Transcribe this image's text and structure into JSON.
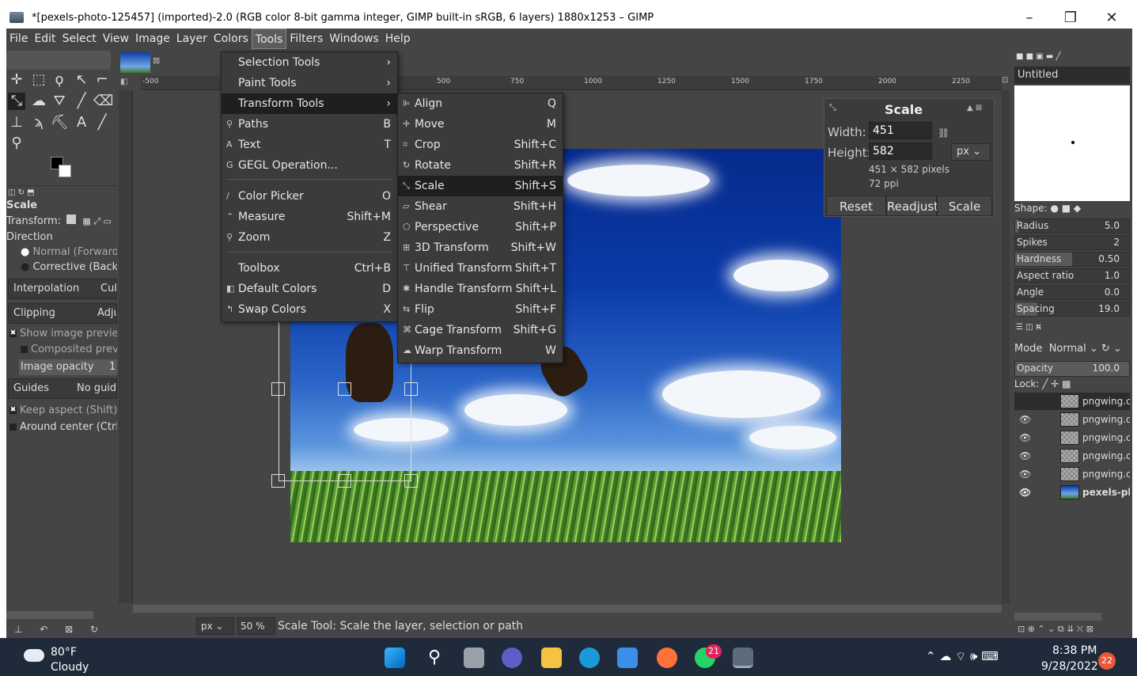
{
  "window": {
    "title": "*[pexels-photo-125457] (imported)-2.0 (RGB color 8-bit gamma integer, GIMP built-in sRGB, 6 layers) 1880x1253 – GIMP",
    "minimize": "–",
    "restore": "❐",
    "close": "✕"
  },
  "menubar": [
    "File",
    "Edit",
    "Select",
    "View",
    "Image",
    "Layer",
    "Colors",
    "Tools",
    "Filters",
    "Windows",
    "Help"
  ],
  "tools_menu": {
    "items": [
      {
        "icon": "",
        "label": "Selection Tools",
        "shortcut": "",
        "arrow": "›"
      },
      {
        "icon": "",
        "label": "Paint Tools",
        "shortcut": "",
        "arrow": "›"
      },
      {
        "icon": "",
        "label": "Transform Tools",
        "shortcut": "",
        "arrow": "›",
        "highlight": true
      },
      {
        "icon": "⚲",
        "label": "Paths",
        "shortcut": "B"
      },
      {
        "icon": "A",
        "label": "Text",
        "shortcut": "T"
      },
      {
        "icon": "G",
        "label": "GEGL Operation...",
        "shortcut": ""
      },
      {
        "icon": "/",
        "label": "Color Picker",
        "shortcut": "O"
      },
      {
        "icon": "⌃",
        "label": "Measure",
        "shortcut": "Shift+M"
      },
      {
        "icon": "⚲",
        "label": "Zoom",
        "shortcut": "Z"
      },
      {
        "icon": "",
        "label": "Toolbox",
        "shortcut": "Ctrl+B"
      },
      {
        "icon": "◧",
        "label": "Default Colors",
        "shortcut": "D"
      },
      {
        "icon": "↰",
        "label": "Swap Colors",
        "shortcut": "X"
      }
    ]
  },
  "transform_menu": {
    "items": [
      {
        "icon": "⊫",
        "label": "Align",
        "shortcut": "Q"
      },
      {
        "icon": "✛",
        "label": "Move",
        "shortcut": "M"
      },
      {
        "icon": "⌗",
        "label": "Crop",
        "shortcut": "Shift+C"
      },
      {
        "icon": "↻",
        "label": "Rotate",
        "shortcut": "Shift+R"
      },
      {
        "icon": "⤡",
        "label": "Scale",
        "shortcut": "Shift+S",
        "highlight": true
      },
      {
        "icon": "▱",
        "label": "Shear",
        "shortcut": "Shift+H"
      },
      {
        "icon": "⬠",
        "label": "Perspective",
        "shortcut": "Shift+P"
      },
      {
        "icon": "⊞",
        "label": "3D Transform",
        "shortcut": "Shift+W"
      },
      {
        "icon": "⊤",
        "label": "Unified Transform",
        "shortcut": "Shift+T"
      },
      {
        "icon": "✱",
        "label": "Handle Transform",
        "shortcut": "Shift+L"
      },
      {
        "icon": "⇆",
        "label": "Flip",
        "shortcut": "Shift+F"
      },
      {
        "icon": "⌘",
        "label": "Cage Transform",
        "shortcut": "Shift+G"
      },
      {
        "icon": "☁",
        "label": "Warp Transform",
        "shortcut": "W"
      }
    ]
  },
  "scale_dialog": {
    "title": "Scale",
    "width_label": "Width:",
    "width_value": "451",
    "height_label": "Height:",
    "height_value": "582",
    "unit": "px",
    "pixels_info": "451 × 582 pixels",
    "ppi": "72 ppi",
    "reset": "Reset",
    "readjust": "Readjust",
    "scale": "Scale"
  },
  "ruler_labels": [
    "-500",
    "500",
    "750",
    "1000",
    "1250",
    "1500",
    "1750",
    "2000",
    "2250"
  ],
  "tool_options": {
    "title": "Scale",
    "transform_label": "Transform:",
    "direction_label": "Direction",
    "normal": "Normal (Forward)",
    "corrective": "Corrective (Backwa",
    "interpolation": "Interpolation",
    "interpolation_value": "Cub",
    "clipping": "Clipping",
    "clipping_value": "Adju",
    "show_preview": "Show image preview",
    "composited": "Composited preview",
    "image_opacity": "Image opacity",
    "image_opacity_value": "1",
    "guides": "Guides",
    "guides_value": "No guid",
    "keep_aspect": "Keep aspect (Shift)",
    "around_center": "Around center (Ctrl)"
  },
  "brush_panel": {
    "brush_name": "Untitled",
    "shape_label": "Shape:",
    "rows": [
      {
        "label": "Radius",
        "value": "5.0",
        "fill": 0.05
      },
      {
        "label": "Spikes",
        "value": "2",
        "fill": 0.0
      },
      {
        "label": "Hardness",
        "value": "0.50",
        "fill": 0.5
      },
      {
        "label": "Aspect ratio",
        "value": "1.0",
        "fill": 0.0
      },
      {
        "label": "Angle",
        "value": "0.0",
        "fill": 0.0
      },
      {
        "label": "Spacing",
        "value": "19.0",
        "fill": 0.19
      }
    ]
  },
  "layers_panel": {
    "mode_label": "Mode",
    "mode_value": "Normal",
    "opacity_label": "Opacity",
    "opacity_value": "100.0",
    "lock_label": "Lock:",
    "layers": [
      {
        "name": "pngwing.cc",
        "visible": false
      },
      {
        "name": "pngwing.cc",
        "visible": true
      },
      {
        "name": "pngwing.cc",
        "visible": true
      },
      {
        "name": "pngwing.cc",
        "visible": true
      },
      {
        "name": "pngwing.cc",
        "visible": true
      },
      {
        "name": "pexels-ph",
        "visible": true,
        "photo": true
      }
    ]
  },
  "statusbar": {
    "unit": "px",
    "zoom": "50 %",
    "message": "Scale Tool: Scale the layer, selection or path"
  },
  "taskbar": {
    "temperature": "80°F",
    "weather": "Cloudy",
    "time": "8:38 PM",
    "date": "9/28/2022",
    "whatsapp_badge": "21",
    "notifications": "22"
  }
}
